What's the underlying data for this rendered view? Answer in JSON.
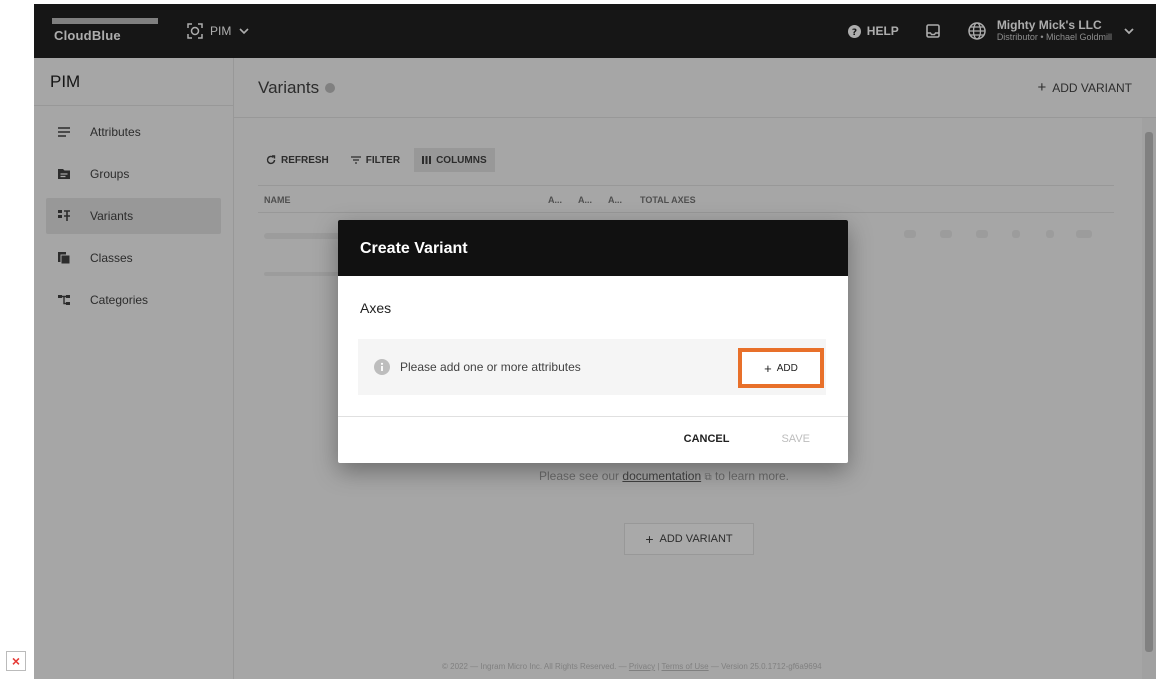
{
  "app": {
    "brand": "CloudBlue",
    "module_name": "PIM",
    "help_label": "HELP",
    "account_name": "Mighty Mick's LLC",
    "account_role": "Distributor • Michael Goldmill"
  },
  "sidebar": {
    "title": "PIM",
    "items": [
      {
        "label": "Attributes",
        "icon": "list-lines-icon"
      },
      {
        "label": "Groups",
        "icon": "folder-icon"
      },
      {
        "label": "Variants",
        "icon": "variants-icon",
        "active": true
      },
      {
        "label": "Classes",
        "icon": "classes-icon"
      },
      {
        "label": "Categories",
        "icon": "tree-icon"
      }
    ]
  },
  "main": {
    "title": "Variants",
    "add_variant_top": "ADD VARIANT",
    "toolbar": {
      "refresh": "REFRESH",
      "filter": "FILTER",
      "columns": "COLUMNS"
    },
    "columns": [
      "NAME",
      "A...",
      "A...",
      "A...",
      "TOTAL AXES"
    ],
    "empty_prefix": "Please see our",
    "empty_link": "documentation",
    "empty_suffix": "to learn more.",
    "add_variant_button": "ADD VARIANT",
    "footer": {
      "copyright": "© 2022 — Ingram Micro Inc. All Rights Reserved. —",
      "privacy": "Privacy",
      "sep": "|",
      "terms": "Terms of Use",
      "version": "— Version 25.0.1712-gf6a9694"
    }
  },
  "modal": {
    "title": "Create Variant",
    "section": "Axes",
    "info_message": "Please add one or more attributes",
    "add_label": "ADD",
    "cancel_label": "CANCEL",
    "save_label": "SAVE"
  },
  "colors": {
    "highlight": "#e8702a",
    "topbar": "#212121",
    "modal_header": "#111111"
  }
}
